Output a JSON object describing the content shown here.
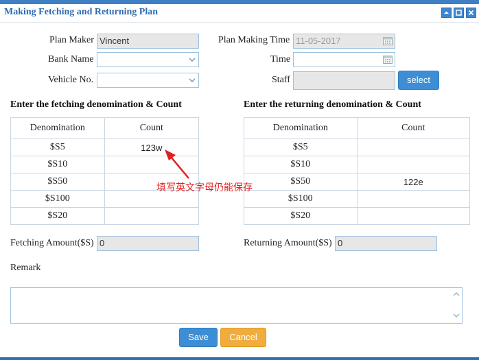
{
  "window": {
    "title": "Making Fetching and Returning Plan"
  },
  "form": {
    "plan_maker_label": "Plan Maker",
    "plan_maker_value": "Vincent",
    "plan_time_label": "Plan Making Time",
    "plan_time_value": "11-05-2017",
    "bank_name_label": "Bank Name",
    "bank_name_value": "",
    "time_label": "Time",
    "time_value": "",
    "vehicle_label": "Vehicle No.",
    "vehicle_value": "",
    "staff_label": "Staff",
    "staff_value": "",
    "select_label": "select"
  },
  "fetching": {
    "heading": "Enter the fetching denomination & Count",
    "col_denomination": "Denomination",
    "col_count": "Count",
    "rows": [
      {
        "denomination": "$S5",
        "count": "123w"
      },
      {
        "denomination": "$S10",
        "count": ""
      },
      {
        "denomination": "$S50",
        "count": ""
      },
      {
        "denomination": "$S100",
        "count": ""
      },
      {
        "denomination": "$S20",
        "count": ""
      }
    ],
    "amount_label": "Fetching Amount($S)",
    "amount_value": "0"
  },
  "returning": {
    "heading": "Enter the returning denomination & Count",
    "col_denomination": "Denomination",
    "col_count": "Count",
    "rows": [
      {
        "denomination": "$S5",
        "count": ""
      },
      {
        "denomination": "$S10",
        "count": ""
      },
      {
        "denomination": "$S50",
        "count": "122e"
      },
      {
        "denomination": "$S100",
        "count": ""
      },
      {
        "denomination": "$S20",
        "count": ""
      }
    ],
    "amount_label": "Returning Amount($S)",
    "amount_value": "0"
  },
  "remark": {
    "label": "Remark",
    "value": ""
  },
  "annotation": {
    "text": "填写英文字母仍能保存",
    "color": "#e02020"
  },
  "actions": {
    "save_label": "Save",
    "cancel_label": "Cancel"
  },
  "colors": {
    "accent": "#3f7fc4",
    "button_blue": "#3e8ed5",
    "button_orange": "#f0ad3d"
  }
}
